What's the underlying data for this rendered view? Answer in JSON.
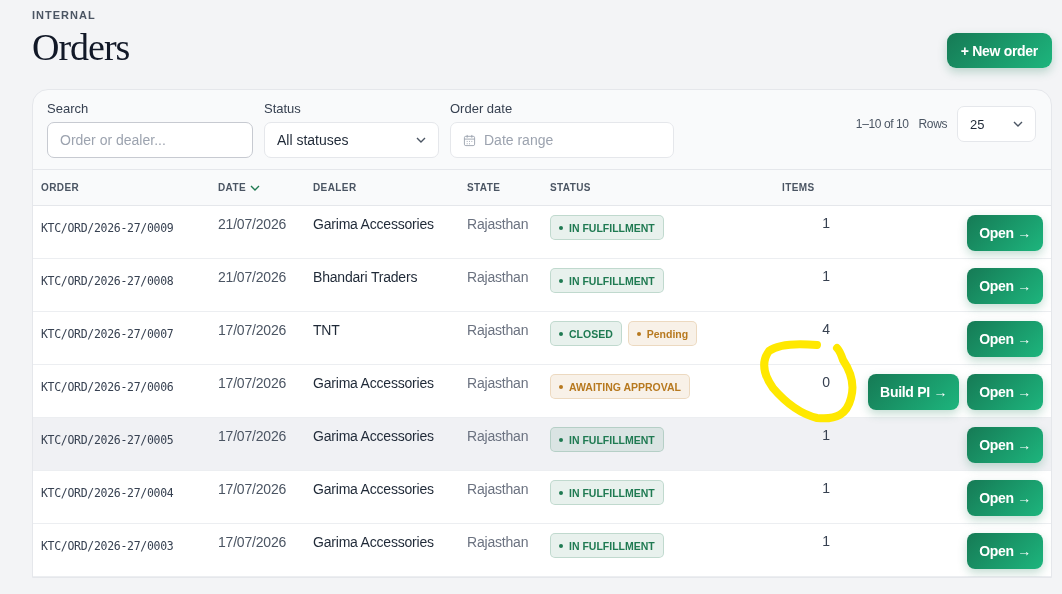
{
  "header": {
    "eyebrow": "INTERNAL",
    "title": "Orders",
    "new_button": "+ New order"
  },
  "filters": [
    {
      "kind": "search",
      "label": "Search",
      "placeholder": "Order or dealer..."
    },
    {
      "kind": "select",
      "label": "Status",
      "value": "All statuses"
    },
    {
      "kind": "date",
      "label": "Order date",
      "placeholder": "Date range"
    }
  ],
  "pagination": {
    "range": "1–10 of 10",
    "rows_label": "Rows",
    "rows_value": "25"
  },
  "columns": [
    {
      "label": "ORDER",
      "sorted": false
    },
    {
      "label": "DATE",
      "sorted": true
    },
    {
      "label": "DEALER",
      "sorted": false
    },
    {
      "label": "STATE",
      "sorted": false
    },
    {
      "label": "STATUS",
      "sorted": false
    },
    {
      "label": "ITEMS",
      "sorted": false
    }
  ],
  "rows": [
    {
      "order": "KTC/ORD/2026-27/0009",
      "date": "21/07/2026",
      "dealer": "Garima Accessories",
      "state": "Rajasthan",
      "badges": [
        {
          "label": "IN FULFILLMENT",
          "color": "#1f7a52"
        }
      ],
      "items": "1",
      "actions": [
        "Open →"
      ],
      "highlighted": false
    },
    {
      "order": "KTC/ORD/2026-27/0008",
      "date": "21/07/2026",
      "dealer": "Bhandari Traders",
      "state": "Rajasthan",
      "badges": [
        {
          "label": "IN FULFILLMENT",
          "color": "#1f7a52"
        }
      ],
      "items": "1",
      "actions": [
        "Open →"
      ],
      "highlighted": false
    },
    {
      "order": "KTC/ORD/2026-27/0007",
      "date": "17/07/2026",
      "dealer": "TNT",
      "state": "Rajasthan",
      "badges": [
        {
          "label": "CLOSED",
          "color": "#1f7a52"
        },
        {
          "label": "Pending",
          "color": "#b7791f"
        }
      ],
      "items": "4",
      "actions": [
        "Open →"
      ],
      "highlighted": false
    },
    {
      "order": "KTC/ORD/2026-27/0006",
      "date": "17/07/2026",
      "dealer": "Garima Accessories",
      "state": "Rajasthan",
      "badges": [
        {
          "label": "AWAITING APPROVAL",
          "color": "#b7791f"
        }
      ],
      "items": "0",
      "actions": [
        "Build PI →",
        "Open →"
      ],
      "highlighted": false
    },
    {
      "order": "KTC/ORD/2026-27/0005",
      "date": "17/07/2026",
      "dealer": "Garima Accessories",
      "state": "Rajasthan",
      "badges": [
        {
          "label": "IN FULFILLMENT",
          "color": "#1f7a52"
        }
      ],
      "items": "1",
      "actions": [
        "Open →"
      ],
      "highlighted": true
    },
    {
      "order": "KTC/ORD/2026-27/0004",
      "date": "17/07/2026",
      "dealer": "Garima Accessories",
      "state": "Rajasthan",
      "badges": [
        {
          "label": "IN FULFILLMENT",
          "color": "#1f7a52"
        }
      ],
      "items": "1",
      "actions": [
        "Open →"
      ],
      "highlighted": false
    },
    {
      "order": "KTC/ORD/2026-27/0003",
      "date": "17/07/2026",
      "dealer": "Garima Accessories",
      "state": "Rajasthan",
      "badges": [
        {
          "label": "IN FULFILLMENT",
          "color": "#1f7a52"
        }
      ],
      "items": "1",
      "actions": [
        "Open →"
      ],
      "highlighted": false
    }
  ],
  "annotation": {
    "kind": "circle"
  }
}
